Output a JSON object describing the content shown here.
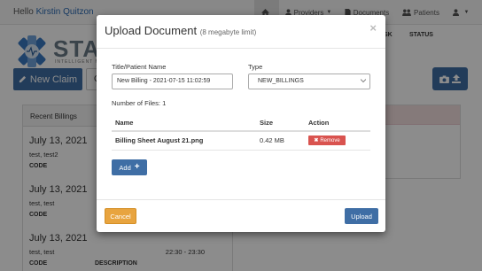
{
  "header": {
    "greeting": "Hello",
    "user_name": "Kirstin Quitzon",
    "nav": {
      "providers": "Providers",
      "documents": "Documents",
      "patients": "Patients"
    }
  },
  "logo": {
    "text": "STAT",
    "subtitle": "INTELLIGENT M"
  },
  "toolbar": {
    "new_claim": "New Claim",
    "partial_button_char": "C"
  },
  "recent_billings": {
    "title": "Recent Billings",
    "items": [
      {
        "date": "July 13, 2021",
        "names": "test, test2",
        "time": "",
        "col1": "CODE",
        "col2": ""
      },
      {
        "date": "July 13, 2021",
        "names": "test, test",
        "time": "",
        "col1": "CODE",
        "col2": ""
      },
      {
        "date": "July 13, 2021",
        "names": "test, test",
        "time": "22:30 - 23:30",
        "col1": "CODE",
        "col2": "DESCRIPTION"
      }
    ]
  },
  "right_panel": {
    "col_task": "SK",
    "col_status": "STATUS"
  },
  "modal": {
    "title": "Upload Document",
    "subtitle": "(8 megabyte limit)",
    "close_symbol": "×",
    "name_label": "Title/Patient Name",
    "name_value": "New Billing - 2021-07-15 11:02:59",
    "type_label": "Type",
    "type_value": "NEW_BILLINGS",
    "files_count_text": "Number of Files: 1",
    "table": {
      "headers": {
        "name": "Name",
        "size": "Size",
        "action": "Action"
      },
      "rows": [
        {
          "name": "Billing Sheet August 21.png",
          "size": "0.42 MB",
          "action_label": "Remove"
        }
      ]
    },
    "add_label": "Add",
    "cancel_label": "Cancel",
    "upload_label": "Upload"
  },
  "colors": {
    "primary": "#3f6ea5",
    "danger": "#d9534f",
    "warning": "#e8a43f",
    "alert_bg": "#f2dede"
  }
}
